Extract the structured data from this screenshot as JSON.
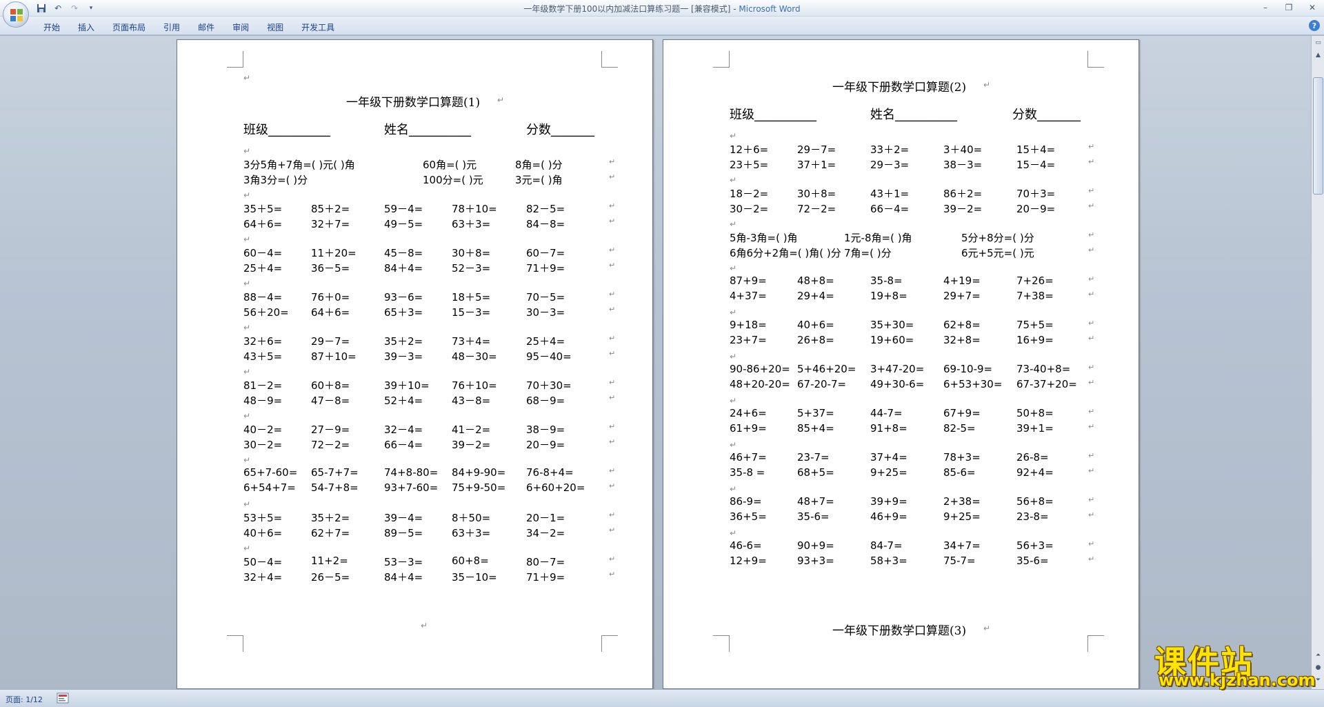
{
  "window": {
    "title": "一年级数学下册100以内加减法口算练习题一 [兼容模式] - ",
    "app_name": "Microsoft Word"
  },
  "ribbon": {
    "tabs": [
      "开始",
      "插入",
      "页面布局",
      "引用",
      "邮件",
      "审阅",
      "视图",
      "开发工具"
    ]
  },
  "icons": {
    "office": "office-button-icon",
    "save": "save-icon",
    "undo": "undo-icon",
    "redo": "redo-icon",
    "help": "help-icon"
  },
  "status": {
    "page": "页面: 1/12"
  },
  "watermark": {
    "text": "课件站",
    "url": "www.kjzhan.com"
  },
  "page1": {
    "title": "一年级下册数学口算题(1)",
    "fields": [
      "班级__________",
      "姓名__________",
      "分数_______"
    ],
    "groups": [
      [
        [
          "3分5角+7角=( )元( )角",
          "60角=( )元",
          "8角=( )分"
        ],
        [
          "3角3分=( )分",
          "100分=( )元",
          "3元=( )角"
        ]
      ],
      [
        [
          "35＋5=",
          "85＋2=",
          "59－4=",
          "78＋10=",
          "82－5="
        ],
        [
          "64＋6=",
          "32＋7=",
          "49－5=",
          "63＋3=",
          "84－8="
        ]
      ],
      [
        [
          "60－4=",
          "11＋20=",
          "45－8=",
          "30＋8=",
          "60－7="
        ],
        [
          "25＋4=",
          "36－5=",
          "84＋4=",
          "52－3=",
          "71＋9="
        ]
      ],
      [
        [
          "88－4=",
          "76＋0=",
          "93－6=",
          "18＋5=",
          "70－5="
        ],
        [
          "56＋20=",
          "64＋6=",
          "65＋3=",
          "15－3=",
          "30－3="
        ]
      ],
      [
        [
          "32＋6=",
          "29－7=",
          "35＋2=",
          "73＋4=",
          "25＋4="
        ],
        [
          "43＋5=",
          "87＋10=",
          "39－3=",
          "48－30=",
          "95－40="
        ]
      ],
      [
        [
          "81－2=",
          "60＋8=",
          "39＋10=",
          "76＋10=",
          "70＋30="
        ],
        [
          "48－9=",
          "47－8=",
          "52＋4=",
          "43－8=",
          "68－9="
        ]
      ],
      [
        [
          "40－2=",
          "27－9=",
          "32－4=",
          "41－2=",
          "38－9="
        ],
        [
          "30－2=",
          "72－2=",
          "66－4=",
          "39－2=",
          "20－9="
        ]
      ],
      [
        [
          "65+7-60=",
          "65-7+7=",
          "74+8-80=",
          "84+9-90=",
          "76-8+4="
        ],
        [
          "6+54+7=",
          "54-7+8=",
          "93+7-60=",
          "75+9-50=",
          "6+60+20="
        ]
      ],
      [
        [
          "53＋5=",
          "35＋2=",
          "39－4=",
          "8＋50=",
          "20－1="
        ],
        [
          "40＋6=",
          "62＋7=",
          "89－5=",
          "63＋3=",
          "34－2="
        ]
      ],
      [
        [
          "50－4=",
          "11+2=",
          "53－3=",
          "60+8=",
          "80－7="
        ],
        [
          "32＋4=",
          "26－5=",
          "84＋4=",
          "35－10=",
          "71＋9="
        ]
      ]
    ]
  },
  "page2": {
    "title": "一年级下册数学口算题(2)",
    "next_title": "一年级下册数学口算题(3)",
    "fields": [
      "班级__________",
      "姓名__________",
      "分数_______"
    ],
    "groups": [
      [
        [
          "12＋6=",
          "29－7=",
          "33＋2=",
          "3＋40=",
          "15＋4="
        ],
        [
          "23＋5=",
          "37＋1=",
          "29－3=",
          "38－3=",
          "15－4="
        ]
      ],
      [
        [
          "18－2=",
          "30＋8=",
          "43＋1=",
          "86＋2=",
          "70＋3="
        ],
        [
          "30－2=",
          "72－2=",
          "66－4=",
          "39－2=",
          "20－9="
        ]
      ],
      [
        [
          "5角-3角=( )角",
          "1元-8角=( )角",
          "5分+8分=( )分"
        ],
        [
          "6角6分+2角=( )角( )分",
          "7角=( )分",
          "6元+5元=( )元"
        ]
      ],
      [
        [
          "87+9=",
          "48+8=",
          "35-8=",
          "4+19=",
          "7+26="
        ],
        [
          "4+37=",
          "29+4=",
          "19+8=",
          "29+7=",
          "7+38="
        ]
      ],
      [
        [
          "9+18=",
          "40+6=",
          "35+30=",
          "62+8=",
          "75+5="
        ],
        [
          "23+7=",
          "26+8=",
          "19+60=",
          "32+8=",
          "16+9="
        ]
      ],
      [
        [
          "90-86+20=",
          "5+46+20=",
          "3+47-20=",
          "69-10-9=",
          "73-40+8="
        ],
        [
          "48+20-20=",
          "67-20-7=",
          "49+30-6=",
          "6+53+30=",
          "67-37+20="
        ]
      ],
      [
        [
          "24+6=",
          "5+37=",
          "44-7=",
          "67+9=",
          "50+8="
        ],
        [
          "61+9=",
          "85+4=",
          "91+8=",
          "82-5=",
          "39+1="
        ]
      ],
      [
        [
          "46+7=",
          "23-7=",
          "37+4=",
          "78+3=",
          "26-8="
        ],
        [
          "35-8 =",
          "68+5=",
          "9+25=",
          "85-6=",
          "92+4="
        ]
      ],
      [
        [
          "86-9=",
          "48+7=",
          "39+9=",
          "2+38=",
          "56+8="
        ],
        [
          "36+5=",
          "35-6=",
          "46+9=",
          "9+25=",
          "23-8="
        ]
      ],
      [
        [
          "46-6=",
          "90+9=",
          "84-7=",
          "34+7=",
          "56+3="
        ],
        [
          "12+9=",
          "93+3=",
          "58+3=",
          "75-7=",
          "35-6="
        ]
      ]
    ]
  }
}
